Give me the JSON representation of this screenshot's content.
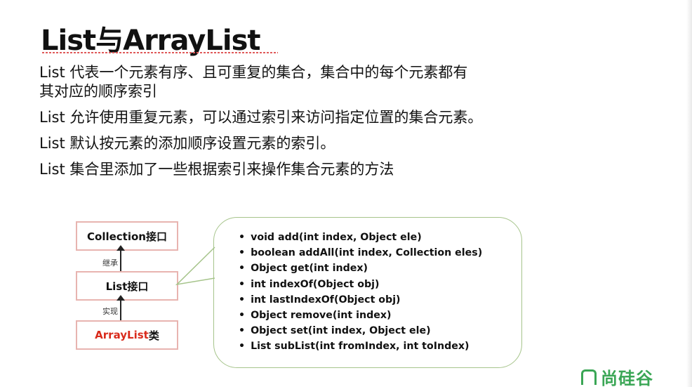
{
  "slide": {
    "title": "List与ArrayList",
    "bullets": [
      {
        "lines": [
          "List 代表一个元素有序、且可重复的集合，集合中的每个元素都有",
          "其对应的顺序索引"
        ]
      },
      {
        "lines": [
          "List 允许使用重复元素，可以通过索引来访问指定位置的集合元素。"
        ]
      },
      {
        "lines": [
          "List 默认按元素的添加顺序设置元素的索引。"
        ]
      },
      {
        "lines": [
          "List 集合里添加了一些根据索引来操作集合元素的方法"
        ]
      }
    ]
  },
  "diagram": {
    "boxes": {
      "collection": "Collection接口",
      "list": "List接口",
      "arraylist_name": "ArrayList",
      "arraylist_suffix": "类"
    },
    "relations": {
      "inherit": "继承",
      "implement": "实现"
    },
    "methods": [
      "void add(int index, Object ele)",
      "boolean addAll(int index, Collection eles)",
      "Object get(int index)",
      "int indexOf(Object obj)",
      "int lastIndexOf(Object obj)",
      "Object remove(int index)",
      "Object set(int index, Object ele)",
      "List subList(int fromIndex, int toIndex)"
    ],
    "bullet_glyph": "•"
  },
  "logo": {
    "text": "尚硅谷"
  },
  "colors": {
    "box_border": "#e8b4b0",
    "arraylist_text": "#d92b1c",
    "callout_border": "#a6c48b",
    "logo": "#3aa655"
  }
}
